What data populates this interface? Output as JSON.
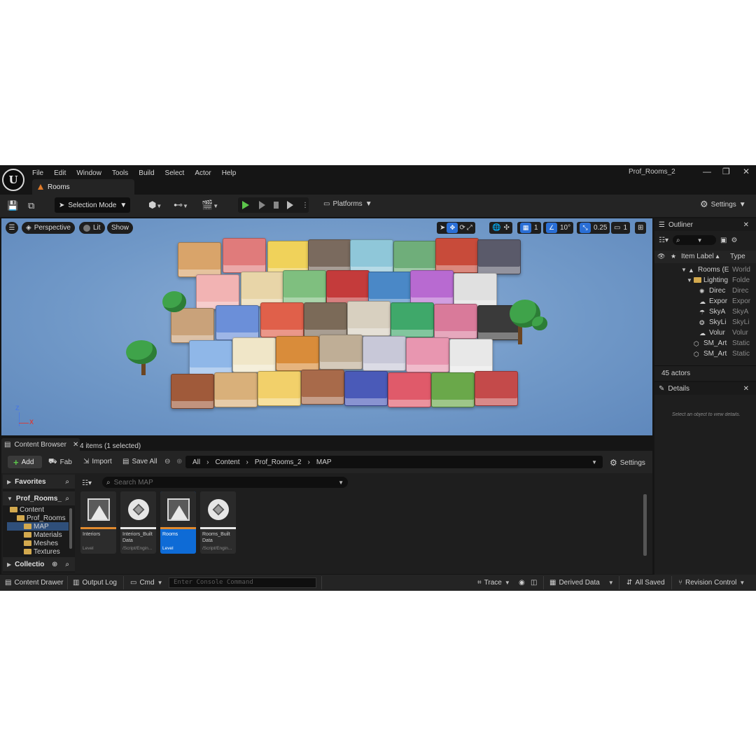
{
  "window": {
    "title": "Prof_Rooms_2",
    "minimize": "—",
    "maximize": "❐",
    "close": "✕"
  },
  "menu": [
    "File",
    "Edit",
    "Window",
    "Tools",
    "Build",
    "Select",
    "Actor",
    "Help"
  ],
  "doc_tab": {
    "label": "Rooms"
  },
  "toolbar": {
    "selection_mode": "Selection Mode",
    "platforms": "Platforms",
    "settings": "Settings"
  },
  "viewport": {
    "perspective": "Perspective",
    "lit": "Lit",
    "show": "Show",
    "grid_size": "1",
    "rotation_snap": "10°",
    "scale_snap": "0.25",
    "camera_speed": "1",
    "axis_z": "Z",
    "axis_x": "X"
  },
  "outliner": {
    "title": "Outliner",
    "col_label": "Item Label ▴",
    "col_type": "Type",
    "rows": [
      {
        "label": "Rooms (E",
        "type": "World",
        "indent": 0,
        "icon": "level-icon"
      },
      {
        "label": "Lighting",
        "type": "Folde",
        "indent": 1,
        "icon": "folder-icon"
      },
      {
        "label": "Direc",
        "type": "Direc",
        "indent": 2,
        "icon": "directional-light-icon"
      },
      {
        "label": "Expor",
        "type": "Expor",
        "indent": 2,
        "icon": "exponential-fog-icon"
      },
      {
        "label": "SkyA",
        "type": "SkyA",
        "indent": 2,
        "icon": "sky-atmosphere-icon"
      },
      {
        "label": "SkyLi",
        "type": "SkyLi",
        "indent": 2,
        "icon": "sky-light-icon"
      },
      {
        "label": "Volur",
        "type": "Volur",
        "indent": 2,
        "icon": "volumetric-cloud-icon"
      },
      {
        "label": "SM_Art",
        "type": "Static",
        "indent": 1,
        "icon": "static-mesh-icon"
      },
      {
        "label": "SM_Art",
        "type": "Static",
        "indent": 1,
        "icon": "static-mesh-icon"
      }
    ],
    "actor_count": "45 actors"
  },
  "details": {
    "title": "Details",
    "empty_hint": "Select an object to view details."
  },
  "content_browser": {
    "tab": "Content Browser",
    "add": "Add",
    "fab": "Fab",
    "import": "Import",
    "save_all": "Save All",
    "path": [
      "All",
      "Content",
      "Prof_Rooms_2",
      "MAP"
    ],
    "settings": "Settings",
    "favorites": "Favorites",
    "project": "Prof_Rooms_",
    "collections": "Collectio",
    "tree": [
      {
        "label": "Content",
        "indent": 0
      },
      {
        "label": "Prof_Rooms",
        "indent": 1
      },
      {
        "label": "MAP",
        "indent": 2,
        "selected": true
      },
      {
        "label": "Materials",
        "indent": 2
      },
      {
        "label": "Meshes",
        "indent": 2
      },
      {
        "label": "Textures",
        "indent": 2
      }
    ],
    "search_placeholder": "Search MAP",
    "assets": [
      {
        "name": "Interiors",
        "type": "Level",
        "kind": "level",
        "bar": "#e08a2e"
      },
      {
        "name": "Interiors_Built Data",
        "type": "/Script/Engin...",
        "kind": "builtdata",
        "bar": "#e8e8e8"
      },
      {
        "name": "Rooms",
        "type": "Level",
        "kind": "level",
        "bar": "#e08a2e",
        "selected": true
      },
      {
        "name": "Rooms_Built Data",
        "type": "/Script/Engin...",
        "kind": "builtdata",
        "bar": "#e8e8e8"
      }
    ],
    "item_count": "4 items (1 selected)"
  },
  "status_bar": {
    "content_drawer": "Content Drawer",
    "output_log": "Output Log",
    "cmd": "Cmd",
    "console_placeholder": "Enter Console Command",
    "trace": "Trace",
    "derived_data": "Derived Data",
    "all_saved": "All Saved",
    "revision_control": "Revision Control"
  },
  "colors": {
    "accent_blue": "#0e6bd6",
    "play_green": "#5cc64b",
    "level_orange": "#e08a2e",
    "viewport_sky": "#7199c8"
  }
}
